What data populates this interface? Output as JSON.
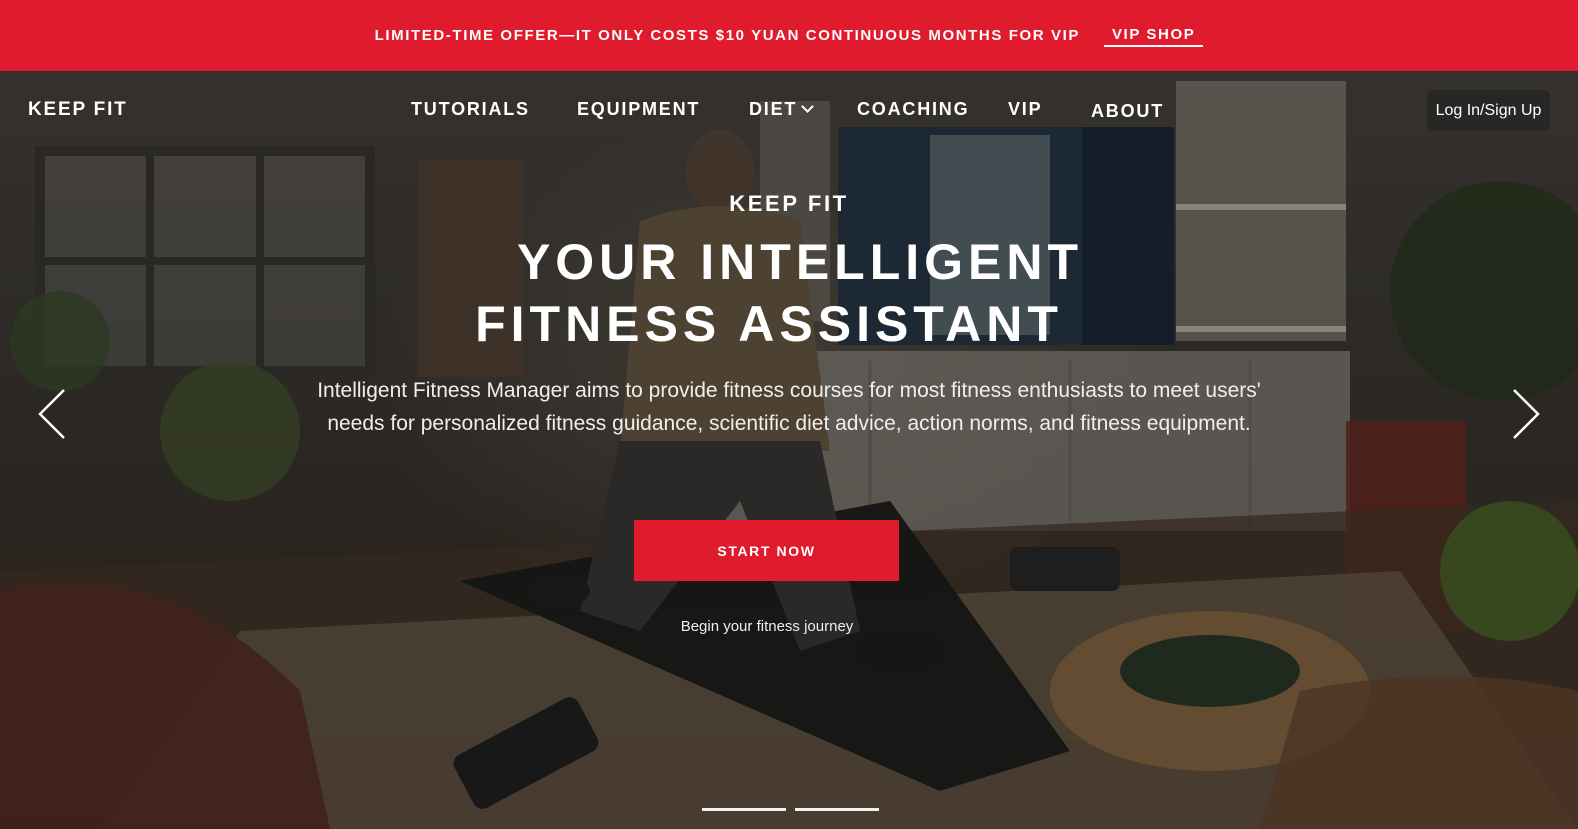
{
  "promo": {
    "text": "LIMITED-TIME OFFER—IT ONLY COSTS $10 YUAN CONTINUOUS MONTHS FOR VIP",
    "link": "VIP SHOP"
  },
  "nav": {
    "brand": "KEEP FIT",
    "items": [
      {
        "label": "TUTORIALS"
      },
      {
        "label": "EQUIPMENT"
      },
      {
        "label": "DIET",
        "has_dropdown": true
      },
      {
        "label": "COACHING"
      },
      {
        "label": "VIP"
      },
      {
        "label": "ABOUT"
      }
    ],
    "login": "Log In/Sign Up"
  },
  "hero": {
    "eyebrow": "KEEP FIT",
    "headline_line1": "YOUR INTELLIGENT",
    "headline_line2": "FITNESS ASSISTANT",
    "description": "Intelligent Fitness Manager aims to provide fitness courses for most fitness enthusiasts to meet users' needs for personalized fitness guidance, scientific diet advice, action norms, and fitness equipment.",
    "cta": "START NOW",
    "cta_caption": "Begin your fitness journey"
  },
  "carousel": {
    "slide_count": 2,
    "prev_icon": "chevron-left-icon",
    "next_icon": "chevron-right-icon"
  },
  "colors": {
    "accent": "#e01b2e",
    "text": "#ffffff"
  }
}
